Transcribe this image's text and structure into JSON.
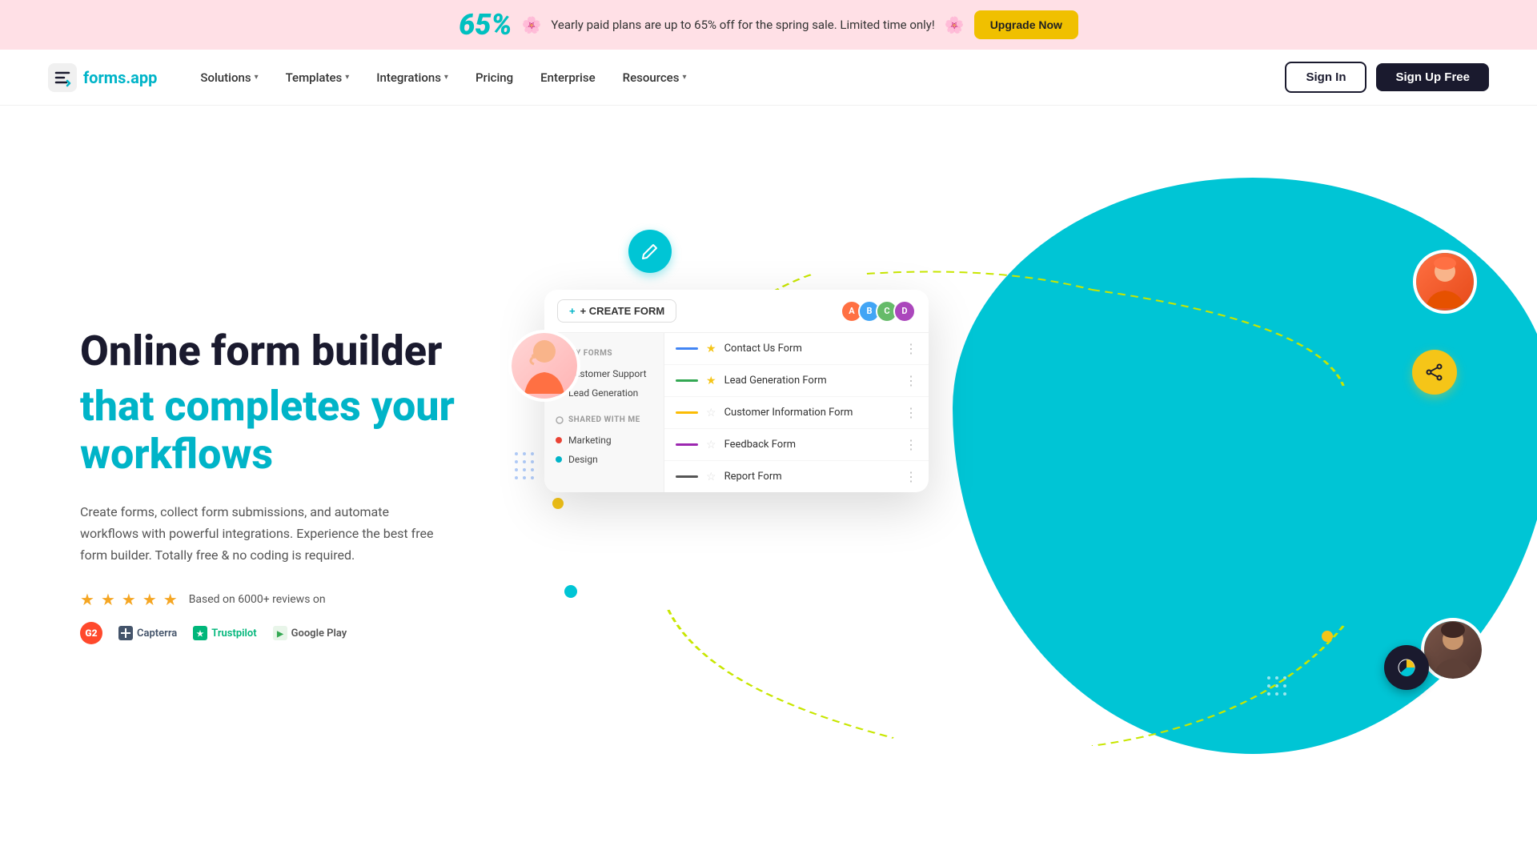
{
  "banner": {
    "percent": "65%",
    "text": "Yearly paid plans are up to 65% off for the spring sale. Limited time only!",
    "emoji": "🌸",
    "btn_label": "Upgrade Now"
  },
  "nav": {
    "logo_text": "forms",
    "logo_dot": ".app",
    "items": [
      {
        "label": "Solutions",
        "has_dropdown": true
      },
      {
        "label": "Templates",
        "has_dropdown": true
      },
      {
        "label": "Integrations",
        "has_dropdown": true
      },
      {
        "label": "Pricing",
        "has_dropdown": false
      },
      {
        "label": "Enterprise",
        "has_dropdown": false
      },
      {
        "label": "Resources",
        "has_dropdown": true
      }
    ],
    "signin_label": "Sign In",
    "signup_label": "Sign Up Free"
  },
  "hero": {
    "title": "Online form builder",
    "subtitle": "that completes your workflows",
    "description": "Create forms, collect form submissions, and automate workflows with powerful integrations. Experience the best free form builder. Totally free & no coding is required.",
    "reviews_text": "Based on 6000+ reviews on",
    "stars": 5,
    "review_sources": [
      {
        "name": "G2",
        "type": "g2"
      },
      {
        "name": "Capterra",
        "type": "capterra"
      },
      {
        "name": "Trustpilot",
        "type": "trustpilot"
      },
      {
        "name": "Google Play",
        "type": "gplay"
      }
    ]
  },
  "dashboard": {
    "create_btn": "+ CREATE FORM",
    "sidebar": {
      "my_forms_label": "MY FORMS",
      "my_forms_items": [
        {
          "label": "Customer Support",
          "color": "yellow"
        },
        {
          "label": "Lead Generation",
          "color": "blue"
        }
      ],
      "shared_label": "SHARED WITH ME",
      "shared_items": [
        {
          "label": "Marketing",
          "color": "red"
        },
        {
          "label": "Design",
          "color": "cyan"
        }
      ]
    },
    "forms": [
      {
        "name": "Contact Us Form",
        "bar_color": "blue",
        "starred": true
      },
      {
        "name": "Lead Generation Form",
        "bar_color": "green",
        "starred": true
      },
      {
        "name": "Customer Information Form",
        "bar_color": "orange",
        "starred": false
      },
      {
        "name": "Feedback Form",
        "bar_color": "purple",
        "starred": false
      },
      {
        "name": "Report Form",
        "bar_color": "dark",
        "starred": false
      }
    ]
  }
}
